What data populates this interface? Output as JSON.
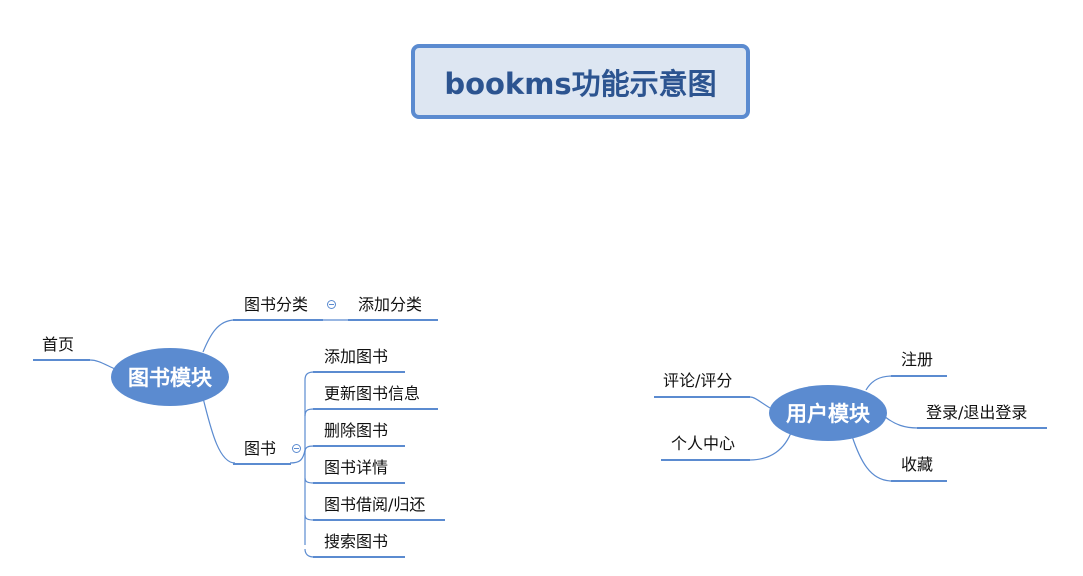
{
  "title": "bookms功能示意图",
  "book_module": {
    "label": "图书模块",
    "home": "首页",
    "category": {
      "label": "图书分类",
      "children": [
        "添加分类"
      ]
    },
    "books": {
      "label": "图书",
      "children": [
        "添加图书",
        "更新图书信息",
        "删除图书",
        "图书详情",
        "图书借阅/归还",
        "搜索图书"
      ]
    }
  },
  "user_module": {
    "label": "用户模块",
    "left": [
      "评论/评分",
      "个人中心"
    ],
    "right": [
      "注册",
      "登录/退出登录",
      "收藏"
    ]
  },
  "colors": {
    "accent": "#5b8bd0",
    "title_bg": "#dde6f2",
    "title_text": "#2c5490"
  }
}
